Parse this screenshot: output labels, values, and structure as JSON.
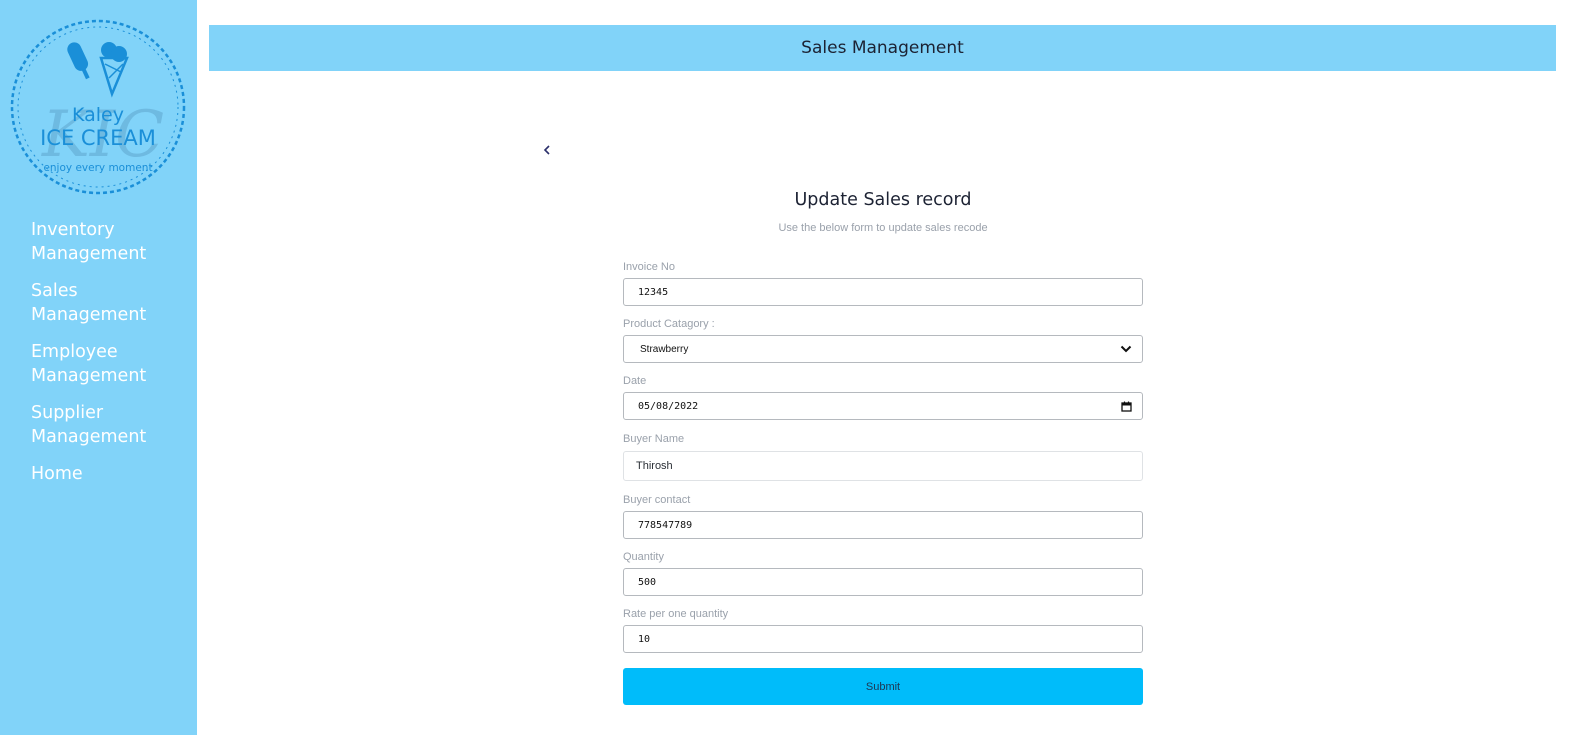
{
  "brand": {
    "logo_brand": "Kaley",
    "logo_name": "ICE CREAM",
    "logo_tagline": "enjoy every moment",
    "accent_color": "#81d3f9",
    "button_color": "#00bcfa"
  },
  "sidebar": {
    "items": [
      {
        "line1": "Inventory",
        "line2": "Management"
      },
      {
        "line1": "Sales",
        "line2": "Management"
      },
      {
        "line1": "Employee",
        "line2": "Management"
      },
      {
        "line1": "Supplier",
        "line2": "Management"
      },
      {
        "line1": "Home",
        "line2": ""
      }
    ]
  },
  "header": {
    "title": "Sales Management"
  },
  "form": {
    "back_icon": "chevron-left-icon",
    "title": "Update Sales record",
    "subtitle": "Use the below form to update sales recode",
    "invoice": {
      "label": "Invoice No",
      "value": "12345"
    },
    "category": {
      "label": "Product Catagory :",
      "value": "Strawberry"
    },
    "date": {
      "label": "Date",
      "value": "05/08/2022"
    },
    "buyer_name": {
      "label": "Buyer Name",
      "value": "Thirosh"
    },
    "buyer_contact": {
      "label": "Buyer contact",
      "value": "778547789"
    },
    "quantity": {
      "label": "Quantity",
      "value": "500"
    },
    "rate": {
      "label": "Rate per one quantity",
      "value": "10"
    },
    "submit_label": "Submit"
  }
}
